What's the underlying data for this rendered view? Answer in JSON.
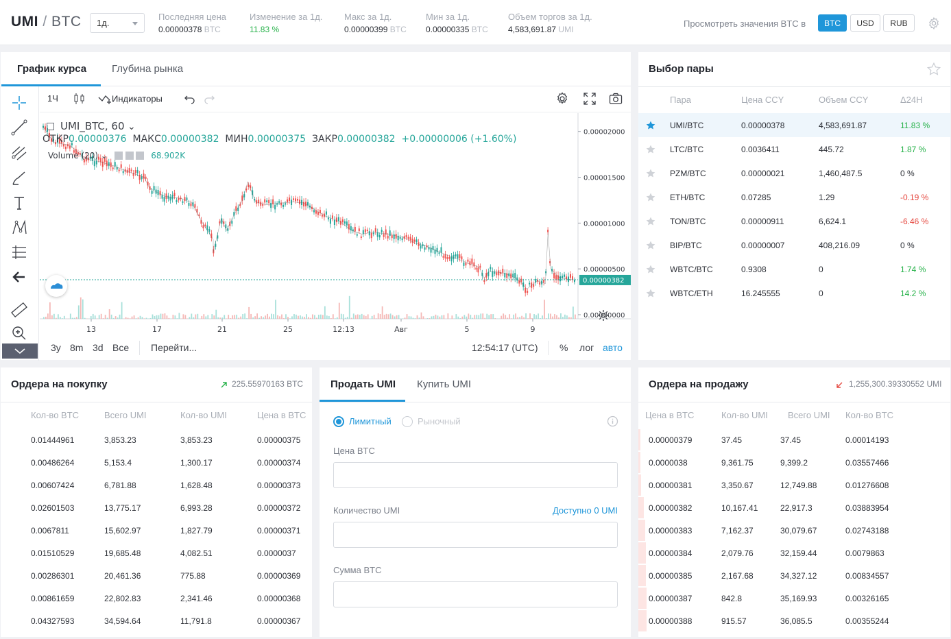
{
  "header": {
    "base": "UMI",
    "quote": "BTC",
    "period": "1д.",
    "stats": [
      {
        "label": "Последняя цена",
        "value": "0.00000378",
        "unit": "BTC"
      },
      {
        "label": "Изменение за 1д.",
        "value": "11.83 %",
        "unit": ""
      },
      {
        "label": "Макс за 1д.",
        "value": "0.00000399",
        "unit": "BTC"
      },
      {
        "label": "Мин за 1д.",
        "value": "0.00000335",
        "unit": "BTC"
      },
      {
        "label": "Объем торгов за 1д.",
        "value": "4,583,691.87",
        "unit": "UMI"
      }
    ],
    "view_label": "Просмотреть значения BTC в",
    "currencies": [
      "BTC",
      "USD",
      "RUB"
    ],
    "active_currency": "BTC",
    "accent": "#1f96d9"
  },
  "chart_panel": {
    "tabs": [
      "График курса",
      "Глубина рынка"
    ],
    "toolbar": {
      "interval": "1Ч",
      "indicators": "Индикаторы"
    },
    "legend": {
      "symbol": "UMI_BTC, 60",
      "o_label": "ОТКР",
      "o": "0.00000376",
      "h_label": "МАКС",
      "h": "0.00000382",
      "l_label": "МИН",
      "l": "0.00000375",
      "c_label": "ЗАКР",
      "c": "0.00000382",
      "change": "+0.00000006 (+1.60%)",
      "volume_label": "Volume (20)",
      "volume": "68.902K"
    },
    "bottom": {
      "ranges": [
        "3у",
        "8m",
        "3d",
        "Все"
      ],
      "goto": "Перейти...",
      "time": "12:54:17 (UTC)",
      "pct": "%",
      "log": "лог",
      "auto": "авто"
    }
  },
  "chart_data": {
    "type": "candlestick",
    "x_ticks": [
      "13",
      "17",
      "21",
      "25",
      "12:13",
      "Авг",
      "5",
      "9"
    ],
    "y_ticks": [
      "0.00002000",
      "0.00001500",
      "0.00001000",
      "0.00000500",
      "0.00000000"
    ],
    "ylim": [
      0,
      2.2e-05
    ],
    "last_price_label": "0.00000382",
    "last_price": 3.82e-06,
    "path": [
      [
        0,
        2.05e-05
      ],
      [
        0.02,
        1.88e-05
      ],
      [
        0.05,
        1.85e-05
      ],
      [
        0.08,
        1.7e-05
      ],
      [
        0.1,
        1.68e-05
      ],
      [
        0.13,
        1.63e-05
      ],
      [
        0.16,
        1.56e-05
      ],
      [
        0.19,
        1.5e-05
      ],
      [
        0.2,
        1.38e-05
      ],
      [
        0.23,
        1.29e-05
      ],
      [
        0.26,
        1.27e-05
      ],
      [
        0.28,
        1.22e-05
      ],
      [
        0.3,
        1e-05
      ],
      [
        0.32,
        8.2e-06
      ],
      [
        0.32,
        6.8e-06
      ],
      [
        0.335,
        1.05e-05
      ],
      [
        0.345,
        9.2e-06
      ],
      [
        0.36,
        1.1e-05
      ],
      [
        0.375,
        1.25e-05
      ],
      [
        0.385,
        1.45e-05
      ],
      [
        0.4,
        1.23e-05
      ],
      [
        0.42,
        1.2e-05
      ],
      [
        0.45,
        1.22e-05
      ],
      [
        0.47,
        1.23e-05
      ],
      [
        0.49,
        1.22e-05
      ],
      [
        0.51,
        1.15e-05
      ],
      [
        0.53,
        1.08e-05
      ],
      [
        0.56,
        1.01e-05
      ],
      [
        0.58,
        9.2e-06
      ],
      [
        0.6,
        8.8e-06
      ],
      [
        0.62,
        9e-06
      ],
      [
        0.65,
        8.8e-06
      ],
      [
        0.68,
        8.4e-06
      ],
      [
        0.7,
        7.8e-06
      ],
      [
        0.72,
        7.5e-06
      ],
      [
        0.74,
        7e-06
      ],
      [
        0.76,
        6.5e-06
      ],
      [
        0.78,
        6.1e-06
      ],
      [
        0.8,
        5.6e-06
      ],
      [
        0.82,
        5.2e-06
      ],
      [
        0.83,
        4e-06
      ],
      [
        0.84,
        4.8e-06
      ],
      [
        0.86,
        4.6e-06
      ],
      [
        0.88,
        4.3e-06
      ],
      [
        0.9,
        3.5e-06
      ],
      [
        0.91,
        2.8e-06
      ],
      [
        0.93,
        3.7e-06
      ],
      [
        0.945,
        3.4e-06
      ],
      [
        0.95,
        9e-06
      ],
      [
        0.955,
        5e-06
      ],
      [
        0.97,
        4.1e-06
      ],
      [
        0.985,
        3.9e-06
      ],
      [
        1,
        3.8e-06
      ]
    ]
  },
  "pairs_panel": {
    "title": "Выбор пары",
    "headers": [
      "Пара",
      "Цена CCY",
      "Объем CCY",
      "Δ24H"
    ],
    "rows": [
      {
        "pair": "UMI/BTC",
        "price": "0.00000378",
        "volume": "4,583,691.87",
        "change": "11.83 %",
        "dir": "up",
        "fav": true
      },
      {
        "pair": "LTC/BTC",
        "price": "0.0036411",
        "volume": "445.72",
        "change": "1.87 %",
        "dir": "up",
        "fav": false
      },
      {
        "pair": "PZM/BTC",
        "price": "0.00000021",
        "volume": "1,460,487.5",
        "change": "0 %",
        "dir": "flat",
        "fav": false
      },
      {
        "pair": "ETH/BTC",
        "price": "0.07285",
        "volume": "1.29",
        "change": "-0.19 %",
        "dir": "down",
        "fav": false
      },
      {
        "pair": "TON/BTC",
        "price": "0.00000911",
        "volume": "6,624.1",
        "change": "-6.46 %",
        "dir": "down",
        "fav": false
      },
      {
        "pair": "BIP/BTC",
        "price": "0.00000007",
        "volume": "408,216.09",
        "change": "0 %",
        "dir": "flat",
        "fav": false
      },
      {
        "pair": "WBTC/BTC",
        "price": "0.9308",
        "volume": "0",
        "change": "1.74 %",
        "dir": "up",
        "fav": false
      },
      {
        "pair": "WBTC/ETH",
        "price": "16.245555",
        "volume": "0",
        "change": "14.2 %",
        "dir": "up",
        "fav": false
      }
    ]
  },
  "buy_orders": {
    "title": "Ордера на покупку",
    "total": "225.55970163 BTC",
    "headers": [
      "Кол-во BTC",
      "Всего UMI",
      "Кол-во UMI",
      "Цена в BTC"
    ],
    "rows": [
      [
        "0.01444961",
        "3,853.23",
        "3,853.23",
        "0.00000375"
      ],
      [
        "0.00486264",
        "5,153.4",
        "1,300.17",
        "0.00000374"
      ],
      [
        "0.00607424",
        "6,781.88",
        "1,628.48",
        "0.00000373"
      ],
      [
        "0.02601503",
        "13,775.17",
        "6,993.28",
        "0.00000372"
      ],
      [
        "0.0067811",
        "15,602.97",
        "1,827.79",
        "0.00000371"
      ],
      [
        "0.01510529",
        "19,685.48",
        "4,082.51",
        "0.0000037"
      ],
      [
        "0.00286301",
        "20,461.36",
        "775.88",
        "0.00000369"
      ],
      [
        "0.00861659",
        "22,802.83",
        "2,341.46",
        "0.00000368"
      ],
      [
        "0.04327593",
        "34,594.64",
        "11,791.8",
        "0.00000367"
      ]
    ]
  },
  "order_form": {
    "tabs": [
      "Продать UMI",
      "Купить UMI"
    ],
    "types": [
      "Лимитный",
      "Рыночный"
    ],
    "price_label": "Цена BTC",
    "qty_label": "Количество UMI",
    "available": "Доступно 0 UMI",
    "sum_label": "Сумма BTC"
  },
  "sell_orders": {
    "title": "Ордера на продажу",
    "total": "1,255,300.39330552 UMI",
    "headers": [
      "Цена в BTC",
      "Кол-во UMI",
      "Всего UMI",
      "Кол-во BTC"
    ],
    "rows": [
      [
        "0.00000379",
        "37.45",
        "37.45",
        "0.00014193"
      ],
      [
        "0.0000038",
        "9,361.75",
        "9,399.2",
        "0.03557466"
      ],
      [
        "0.00000381",
        "3,350.67",
        "12,749.88",
        "0.01276608"
      ],
      [
        "0.00000382",
        "10,167.41",
        "22,917.3",
        "0.03883954"
      ],
      [
        "0.00000383",
        "7,162.37",
        "30,079.67",
        "0.02743188"
      ],
      [
        "0.00000384",
        "2,079.76",
        "32,159.44",
        "0.0079863"
      ],
      [
        "0.00000385",
        "2,167.68",
        "34,327.12",
        "0.00834557"
      ],
      [
        "0.00000387",
        "842.8",
        "35,169.93",
        "0.00326165"
      ],
      [
        "0.00000388",
        "915.57",
        "36,085.5",
        "0.00355244"
      ]
    ]
  }
}
